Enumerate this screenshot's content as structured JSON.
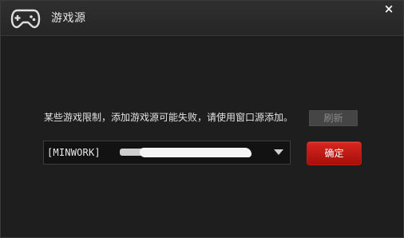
{
  "window": {
    "title": "游戏源",
    "close_label": "×",
    "title_icon": "gamepad-icon"
  },
  "content": {
    "notice": "某些游戏限制，添加游戏源可能失败，请使用窗口源添加。",
    "refresh_label": "刷新",
    "source_select": {
      "value": "[MINWORK]​"
    },
    "confirm_label": "确定"
  },
  "colors": {
    "confirm_red": "#c41a14",
    "background": "#1e1e1e"
  }
}
